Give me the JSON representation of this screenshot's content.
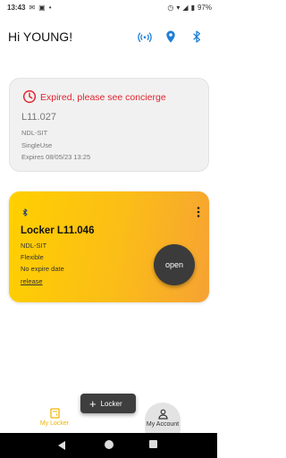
{
  "status_bar": {
    "time": "13:43",
    "battery": "97%"
  },
  "header": {
    "greeting": "Hi YOUNG!",
    "icons": [
      "nfc-icon",
      "location-icon",
      "bluetooth-icon"
    ],
    "icon_color": "#1e7fd6"
  },
  "expired_card": {
    "status": "Expired, please see concierge",
    "status_color": "#e0252f",
    "locker_code": "L11.027",
    "site": "NDL-SIT",
    "usage": "SingleUse",
    "expiry": "Expires 08/05/23 13:25"
  },
  "active_card": {
    "title": "Locker L11.046",
    "site": "NDL-SIT",
    "usage": "Flexible",
    "expiry": "No expire date",
    "release_label": "release",
    "open_label": "open",
    "accent_colors": [
      "#ffd000",
      "#f6a233"
    ]
  },
  "add_button": {
    "label": "Locker"
  },
  "bottom_nav": {
    "my_locker": "My Locker",
    "my_account": "My Account",
    "active_color": "#f2b400"
  }
}
